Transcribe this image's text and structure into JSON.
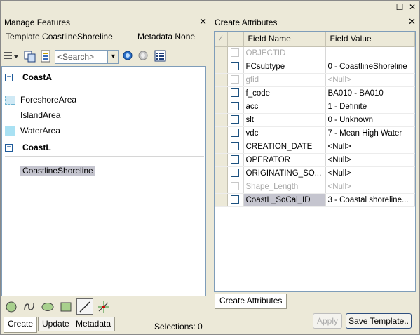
{
  "manage_features": {
    "title": "Manage Features",
    "template_label": "Template CoastlineShoreline",
    "metadata_label": "Metadata None",
    "search_placeholder": "<Search>",
    "groups": [
      {
        "name": "CoastA",
        "items": [
          {
            "label": "ForeshoreArea",
            "icon": "foreshore-area-swatch"
          },
          {
            "label": "IslandArea",
            "icon": "island-area-swatch"
          },
          {
            "label": "WaterArea",
            "icon": "water-area-swatch"
          }
        ]
      },
      {
        "name": "CoastL",
        "items": [
          {
            "label": "CoastlineShoreline",
            "icon": "shoreline-line-swatch",
            "selected": true
          }
        ]
      }
    ],
    "tabs": [
      "Create",
      "Update",
      "Metadata"
    ],
    "active_tab": "Create",
    "selections_label": "Selections: 0"
  },
  "create_attributes": {
    "title": "Create Attributes",
    "columns": [
      "Field Name",
      "Field Value"
    ],
    "rows": [
      {
        "field": "OBJECTID",
        "value": "",
        "enabled": false
      },
      {
        "field": "FCsubtype",
        "value": "0 - CoastlineShoreline",
        "enabled": true
      },
      {
        "field": "gfid",
        "value": "<Null>",
        "enabled": false
      },
      {
        "field": "f_code",
        "value": "BA010 - BA010",
        "enabled": true
      },
      {
        "field": "acc",
        "value": "1 - Definite",
        "enabled": true
      },
      {
        "field": "slt",
        "value": "0 - Unknown",
        "enabled": true
      },
      {
        "field": "vdc",
        "value": "7 - Mean High Water",
        "enabled": true
      },
      {
        "field": "CREATION_DATE",
        "value": "<Null>",
        "enabled": true
      },
      {
        "field": "OPERATOR",
        "value": "<Null>",
        "enabled": true
      },
      {
        "field": "ORIGINATING_SO...",
        "value": "<Null>",
        "enabled": true
      },
      {
        "field": "Shape_Length",
        "value": "<Null>",
        "enabled": false
      },
      {
        "field": "CoastL_SoCal_ID",
        "value": "3 - Coastal shoreline...",
        "enabled": true,
        "highlight": true
      }
    ],
    "tab_label": "Create Attributes",
    "apply_label": "Apply",
    "save_template_label": "Save Template.."
  }
}
